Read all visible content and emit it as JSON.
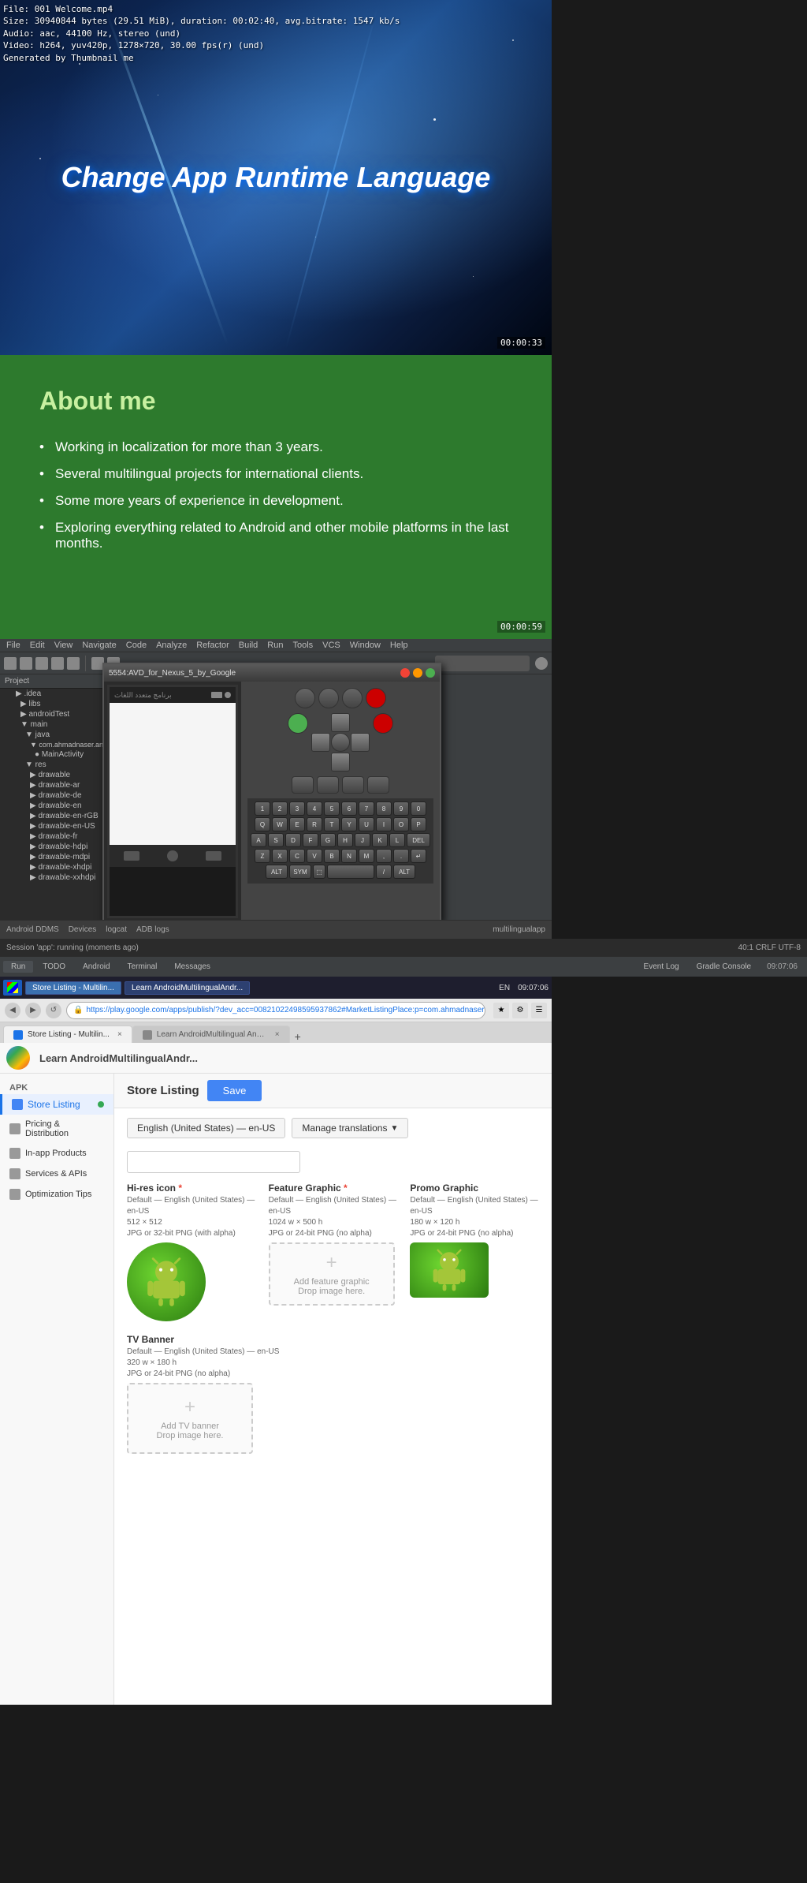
{
  "video": {
    "file_info_line1": "File: 001 Welcome.mp4",
    "file_info_line2": "Size: 30940844 bytes (29.51 MiB), duration: 00:02:40, avg.bitrate: 1547 kb/s",
    "file_info_line3": "Audio: aac, 44100 Hz, stereo (und)",
    "file_info_line4": "Video: h264, yuv420p, 1278×720, 30.00 fps(r) (und)",
    "file_info_line5": "Generated by Thumbnail me",
    "title": "Change App Runtime Language",
    "timestamp": "00:00:33"
  },
  "about": {
    "title": "About me",
    "bullet1": "Working in localization for more than 3 years.",
    "bullet2": "Several multilingual projects for international clients.",
    "bullet3": "Some more years of experience in development.",
    "bullet4": "Exploring everything related to Android and other mobile platforms in the last months.",
    "timestamp": "00:00:59"
  },
  "ide": {
    "menu_items": [
      "File",
      "Edit",
      "View",
      "Navigate",
      "Code",
      "Analyze",
      "Refactor",
      "Build",
      "Run",
      "Tools",
      "VCS",
      "Window",
      "Help"
    ],
    "project_label": "Project",
    "tree_items": [
      {
        "label": "▶ .idea",
        "indent": 2
      },
      {
        "label": "▶ libs",
        "indent": 3
      },
      {
        "label": "▶ androidTest",
        "indent": 3
      },
      {
        "label": "▼ main",
        "indent": 3
      },
      {
        "label": "▼ java",
        "indent": 4
      },
      {
        "label": "▼ com.ahmadnaser.androidmu...",
        "indent": 5
      },
      {
        "label": "● MainActivity",
        "indent": 6
      },
      {
        "label": "▼ res",
        "indent": 4
      },
      {
        "label": "▶ drawable",
        "indent": 5
      },
      {
        "label": "▶ drawable-ar",
        "indent": 5
      },
      {
        "label": "▶ drawable-de",
        "indent": 5
      },
      {
        "label": "▶ drawable-en",
        "indent": 5
      },
      {
        "label": "▶ drawable-en-rGB",
        "indent": 5
      },
      {
        "label": "▶ drawable-en-US",
        "indent": 5
      },
      {
        "label": "▶ drawable-fr",
        "indent": 5
      },
      {
        "label": "▶ drawable-hdpi",
        "indent": 5
      },
      {
        "label": "▶ drawable-mdpi",
        "indent": 5
      },
      {
        "label": "▶ drawable-xhdpi",
        "indent": 5
      },
      {
        "label": "▶ drawable-xxhdpi",
        "indent": 5
      }
    ],
    "emulator_title": "5554:AVD_for_Nexus_5_by_Google",
    "statusbar_text": "برنامج متعدد اللغات",
    "bottom_items": [
      "Android DDMS",
      "Devices",
      "logcat",
      "ADB logs",
      "TODO"
    ],
    "session_label": "Session 'app': running (moments ago)",
    "devices_label": "Devices",
    "run_btn": "Run",
    "todo_btn": "TODO",
    "android_btn": "Android",
    "terminal_btn": "Terminal",
    "messages_btn": "Messages",
    "event_log_btn": "Event Log",
    "gradle_console_btn": "Gradle Console",
    "vd_label": "VD_for_Nexus_5_by",
    "multilingual_label": "multilingualapp",
    "time": "09:07:06",
    "keyboard_rows": [
      [
        "1",
        "2",
        "3",
        "4",
        "5",
        "6",
        "7",
        "8",
        "9",
        "0"
      ],
      [
        "Q",
        "W",
        "E",
        "R",
        "T",
        "Y",
        "U",
        "I",
        "O",
        "P"
      ],
      [
        "A",
        "S",
        "D",
        "F",
        "G",
        "H",
        "J",
        "K",
        "L",
        "DEL"
      ],
      [
        "Z",
        "X",
        "C",
        "V",
        "B",
        "N",
        "M",
        ",",
        ".",
        "↵"
      ],
      [
        "ALT",
        "SYM",
        "⬚",
        " ",
        " ",
        " ",
        " ",
        "/",
        " ",
        "ALT"
      ]
    ]
  },
  "taskbar": {
    "items": [
      {
        "label": "Store Listing - Multilin...",
        "active": true
      },
      {
        "label": "Learn AndroidMultilingualAndr...",
        "active": false
      }
    ],
    "time": "09:07:06",
    "lang": "EN"
  },
  "browser": {
    "url": "https://play.google.com/apps/publish/?dev_acc=00821022498595937862#MarketListingPlace:p=com.ahmadnaser.androidmultilingualapp",
    "tab1": "Store Listing - Multilin...",
    "tab2": "Learn AndroidMultilingual Andro..."
  },
  "console": {
    "sidebar": {
      "section_apk": "APK",
      "item_store_listing": "Store Listing",
      "item_pricing": "Pricing & Distribution",
      "item_in_app": "In-app Products",
      "item_services": "Services & APIs",
      "item_optimization": "Optimization Tips"
    },
    "header": {
      "breadcrumb": "Store Listing",
      "save_label": "Save"
    },
    "lang_btn": "English (United States) — en-US",
    "manage_trans_btn": "Manage translations",
    "graphics": {
      "hi_res_label": "Hi-res icon",
      "hi_res_required": "*",
      "hi_res_sub1": "Default — English (United States) — en-US",
      "hi_res_sub2": "512 × 512",
      "hi_res_sub3": "JPG or 32-bit PNG (with alpha)",
      "feature_label": "Feature Graphic",
      "feature_required": "*",
      "feature_sub1": "Default — English (United States) — en-US",
      "feature_sub2": "1024 w × 500 h",
      "feature_sub3": "JPG or 24-bit PNG (no alpha)",
      "feature_placeholder1": "Add feature graphic",
      "feature_placeholder2": "Drop image here.",
      "promo_label": "Promo Graphic",
      "promo_sub1": "Default — English (United States) — en-US",
      "promo_sub2": "180 w × 120 h",
      "promo_sub3": "JPG or 24-bit PNG (no alpha)",
      "tv_banner_label": "TV Banner",
      "tv_banner_sub1": "Default — English (United States) — en-US",
      "tv_banner_sub2": "320 w × 180 h",
      "tv_banner_sub3": "JPG or 24-bit PNG (no alpha)",
      "tv_banner_placeholder1": "Add TV banner",
      "tv_banner_placeholder2": "Drop image here."
    }
  }
}
